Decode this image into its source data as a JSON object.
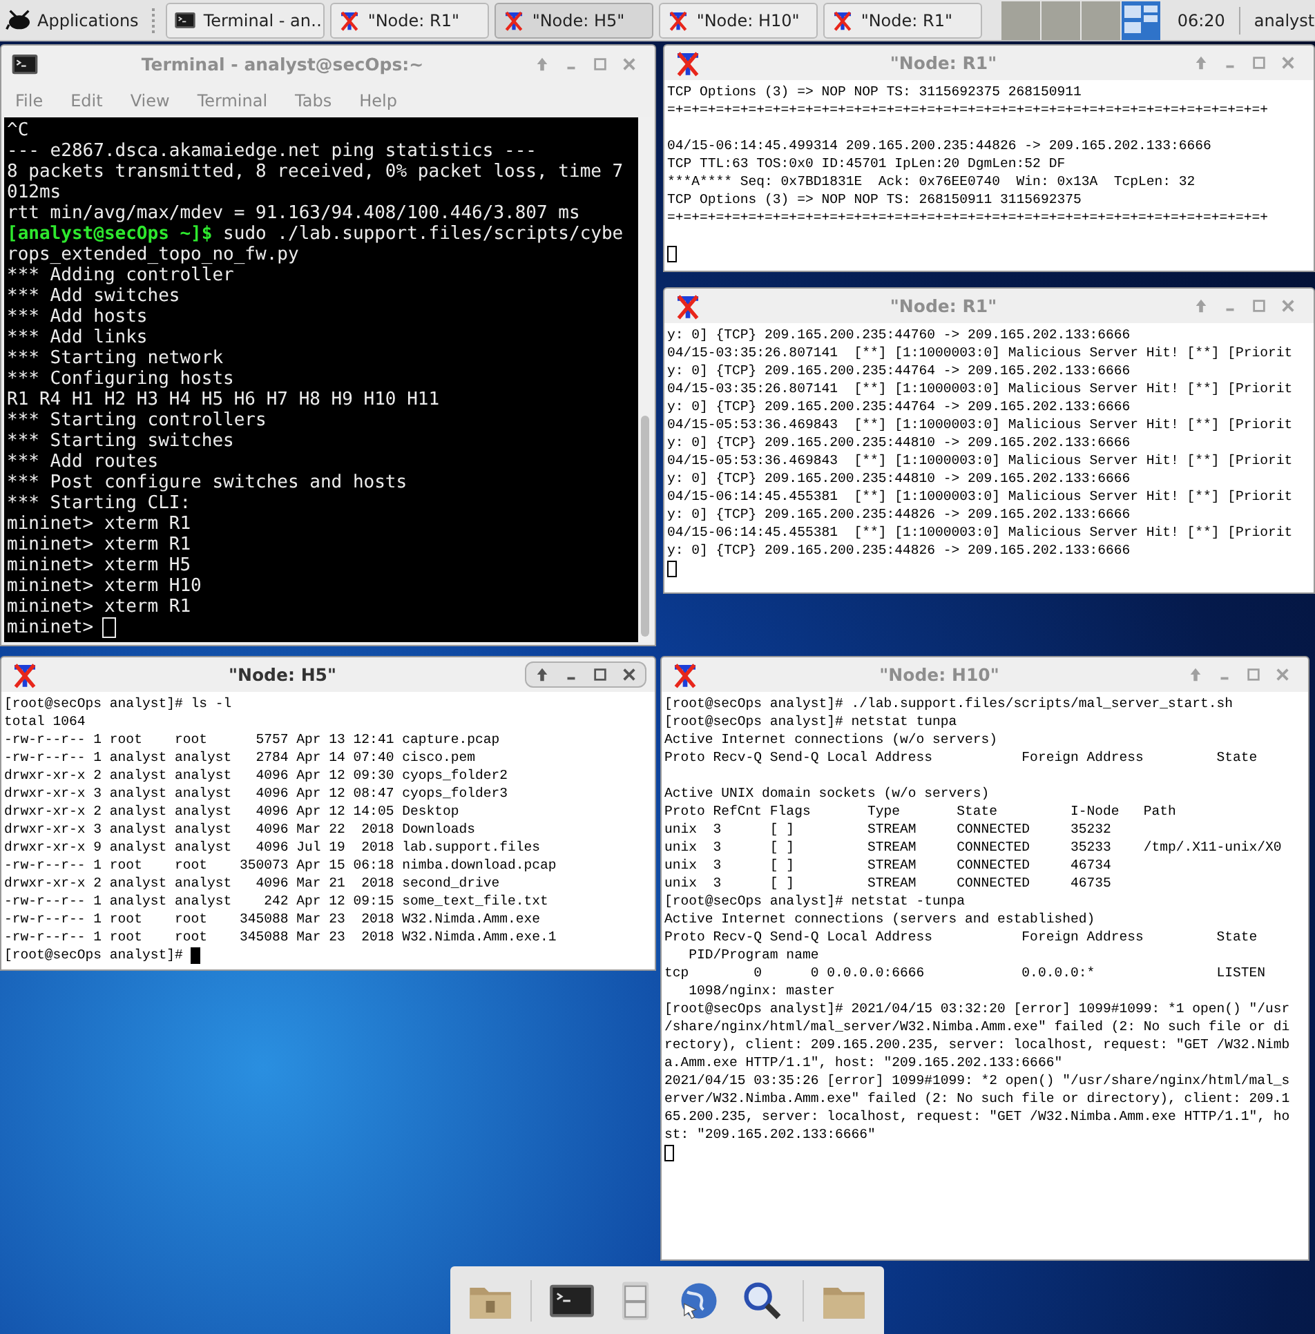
{
  "panel": {
    "apps_menu": "Applications",
    "tasks": [
      {
        "kind": "terminal",
        "label": "Terminal - an…",
        "selected": false
      },
      {
        "kind": "xterm",
        "label": "\"Node: R1\"",
        "selected": false
      },
      {
        "kind": "xterm",
        "label": "\"Node: H5\"",
        "selected": true
      },
      {
        "kind": "xterm",
        "label": "\"Node: H10\"",
        "selected": false
      },
      {
        "kind": "xterm",
        "label": "\"Node: R1\"",
        "selected": false
      }
    ],
    "workspaces": [
      {
        "selected": false
      },
      {
        "selected": false
      },
      {
        "selected": false
      },
      {
        "selected": true
      }
    ],
    "clock": "06:20",
    "user": "analyst"
  },
  "windows": [
    {
      "kind": "terminal",
      "title": "Terminal - analyst@secOps:~",
      "active": false,
      "menu": [
        "File",
        "Edit",
        "View",
        "Terminal",
        "Tabs",
        "Help"
      ],
      "lines": [
        "^C",
        "--- e2867.dsca.akamaiedge.net ping statistics ---",
        "8 packets transmitted, 8 received, 0% packet loss, time 7",
        "012ms",
        "rtt min/avg/max/mdev = 91.163/94.408/100.446/3.807 ms",
        {
          "prompt": "[analyst@secOps ~]$",
          "text": " sudo ./lab.support.files/scripts/cybe"
        },
        "rops_extended_topo_no_fw.py",
        "*** Adding controller",
        "*** Add switches",
        "*** Add hosts",
        "*** Add links",
        "*** Starting network",
        "*** Configuring hosts",
        "R1 R4 H1 H2 H3 H4 H5 H6 H7 H8 H9 H10 H11",
        "*** Starting controllers",
        "*** Starting switches",
        "*** Add routes",
        "*** Post configure switches and hosts",
        "*** Starting CLI:",
        "mininet> xterm R1",
        "mininet> xterm R1",
        "mininet> xterm H5",
        "mininet> xterm H10",
        "mininet> xterm R1"
      ],
      "prompt_line": "mininet>"
    },
    {
      "kind": "xterm",
      "title": "\"Node: R1\"",
      "active": false,
      "lines": [
        "TCP Options (3) => NOP NOP TS: 3115692375 268150911",
        "=+=+=+=+=+=+=+=+=+=+=+=+=+=+=+=+=+=+=+=+=+=+=+=+=+=+=+=+=+=+=+=+=+=+=+=+=+",
        {
          "kind": "blank"
        },
        "04/15-06:14:45.499314 209.165.200.235:44826 -> 209.165.202.133:6666",
        "TCP TTL:63 TOS:0x0 ID:45701 IpLen:20 DgmLen:52 DF",
        "***A**** Seq: 0x7BD1831E  Ack: 0x76EE0740  Win: 0x13A  TcpLen: 32",
        "TCP Options (3) => NOP NOP TS: 268150911 3115692375",
        "=+=+=+=+=+=+=+=+=+=+=+=+=+=+=+=+=+=+=+=+=+=+=+=+=+=+=+=+=+=+=+=+=+=+=+=+=+",
        {
          "kind": "blank"
        }
      ]
    },
    {
      "kind": "xterm",
      "title": "\"Node: R1\"",
      "active": false,
      "lines": [
        "y: 0] {TCP} 209.165.200.235:44760 -> 209.165.202.133:6666",
        "04/15-03:35:26.807141  [**] [1:1000003:0] Malicious Server Hit! [**] [Priorit",
        "y: 0] {TCP} 209.165.200.235:44764 -> 209.165.202.133:6666",
        "04/15-03:35:26.807141  [**] [1:1000003:0] Malicious Server Hit! [**] [Priorit",
        "y: 0] {TCP} 209.165.200.235:44764 -> 209.165.202.133:6666",
        "04/15-05:53:36.469843  [**] [1:1000003:0] Malicious Server Hit! [**] [Priorit",
        "y: 0] {TCP} 209.165.200.235:44810 -> 209.165.202.133:6666",
        "04/15-05:53:36.469843  [**] [1:1000003:0] Malicious Server Hit! [**] [Priorit",
        "y: 0] {TCP} 209.165.200.235:44810 -> 209.165.202.133:6666",
        "04/15-06:14:45.455381  [**] [1:1000003:0] Malicious Server Hit! [**] [Priorit",
        "y: 0] {TCP} 209.165.200.235:44826 -> 209.165.202.133:6666",
        "04/15-06:14:45.455381  [**] [1:1000003:0] Malicious Server Hit! [**] [Priorit",
        "y: 0] {TCP} 209.165.200.235:44826 -> 209.165.202.133:6666"
      ]
    },
    {
      "kind": "xterm",
      "title": "\"Node: H5\"",
      "active": true,
      "lines": [
        "[root@secOps analyst]# ls -l",
        "total 1064",
        "-rw-r--r-- 1 root    root      5757 Apr 13 12:41 capture.pcap",
        "-rw-r--r-- 1 analyst analyst   2784 Apr 14 07:40 cisco.pem",
        "drwxr-xr-x 2 analyst analyst   4096 Apr 12 09:30 cyops_folder2",
        "drwxr-xr-x 3 analyst analyst   4096 Apr 12 08:47 cyops_folder3",
        "drwxr-xr-x 2 analyst analyst   4096 Apr 12 14:05 Desktop",
        "drwxr-xr-x 3 analyst analyst   4096 Mar 22  2018 Downloads",
        "drwxr-xr-x 9 analyst analyst   4096 Jul 19  2018 lab.support.files",
        "-rw-r--r-- 1 root    root    350073 Apr 15 06:18 nimba.download.pcap",
        "drwxr-xr-x 2 analyst analyst   4096 Mar 21  2018 second_drive",
        "-rw-r--r-- 1 analyst analyst    242 Apr 12 09:15 some_text_file.txt",
        "-rw-r--r-- 1 root    root    345088 Mar 23  2018 W32.Nimda.Amm.exe",
        "-rw-r--r-- 1 root    root    345088 Mar 23  2018 W32.Nimda.Amm.exe.1"
      ],
      "prompt_line": "[root@secOps analyst]#"
    },
    {
      "kind": "xterm",
      "title": "\"Node: H10\"",
      "active": false,
      "lines": [
        "[root@secOps analyst]# ./lab.support.files/scripts/mal_server_start.sh",
        "[root@secOps analyst]# netstat tunpa",
        "Active Internet connections (w/o servers)",
        "Proto Recv-Q Send-Q Local Address           Foreign Address         State",
        {
          "kind": "blank"
        },
        "Active UNIX domain sockets (w/o servers)",
        "Proto RefCnt Flags       Type       State         I-Node   Path",
        "unix  3      [ ]         STREAM     CONNECTED     35232",
        "unix  3      [ ]         STREAM     CONNECTED     35233    /tmp/.X11-unix/X0",
        "unix  3      [ ]         STREAM     CONNECTED     46734",
        "unix  3      [ ]         STREAM     CONNECTED     46735",
        "[root@secOps analyst]# netstat -tunpa",
        "Active Internet connections (servers and established)",
        "Proto Recv-Q Send-Q Local Address           Foreign Address         State",
        "   PID/Program name",
        "tcp        0      0 0.0.0.0:6666            0.0.0.0:*               LISTEN",
        "   1098/nginx: master",
        "[root@secOps analyst]# 2021/04/15 03:32:20 [error] 1099#1099: *1 open() \"/usr",
        "/share/nginx/html/mal_server/W32.Nimba.Amm.exe\" failed (2: No such file or di",
        "rectory), client: 209.165.200.235, server: localhost, request: \"GET /W32.Nimb",
        "a.Amm.exe HTTP/1.1\", host: \"209.165.202.133:6666\"",
        "2021/04/15 03:35:26 [error] 1099#1099: *2 open() \"/usr/share/nginx/html/mal_s",
        "erver/W32.Nimba.Amm.exe\" failed (2: No such file or directory), client: 209.1",
        "65.200.235, server: localhost, request: \"GET /W32.Nimba.Amm.exe HTTP/1.1\", ho",
        "st: \"209.165.202.133:6666\""
      ]
    }
  ]
}
